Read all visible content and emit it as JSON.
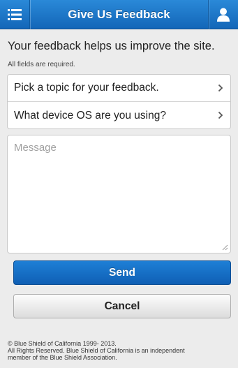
{
  "header": {
    "title": "Give Us Feedback",
    "menu_icon": "list-menu-icon",
    "profile_icon": "user-profile-icon",
    "bar_color": "#1a74c7"
  },
  "form": {
    "intro": "Your feedback helps us improve the site.",
    "required_note": "All fields are required.",
    "topic_select": "Pick a topic for your feedback.",
    "os_select": "What device OS are you using?",
    "message_placeholder": "Message",
    "message_value": ""
  },
  "actions": {
    "send_label": "Send",
    "cancel_label": "Cancel",
    "send_color": "#1565c0"
  },
  "footer": {
    "line1": "© Blue Shield of California 1999- 2013.",
    "line2": "All Rights Reserved. Blue Shield of California is an independent",
    "line3": "member of the Blue Shield Association."
  }
}
